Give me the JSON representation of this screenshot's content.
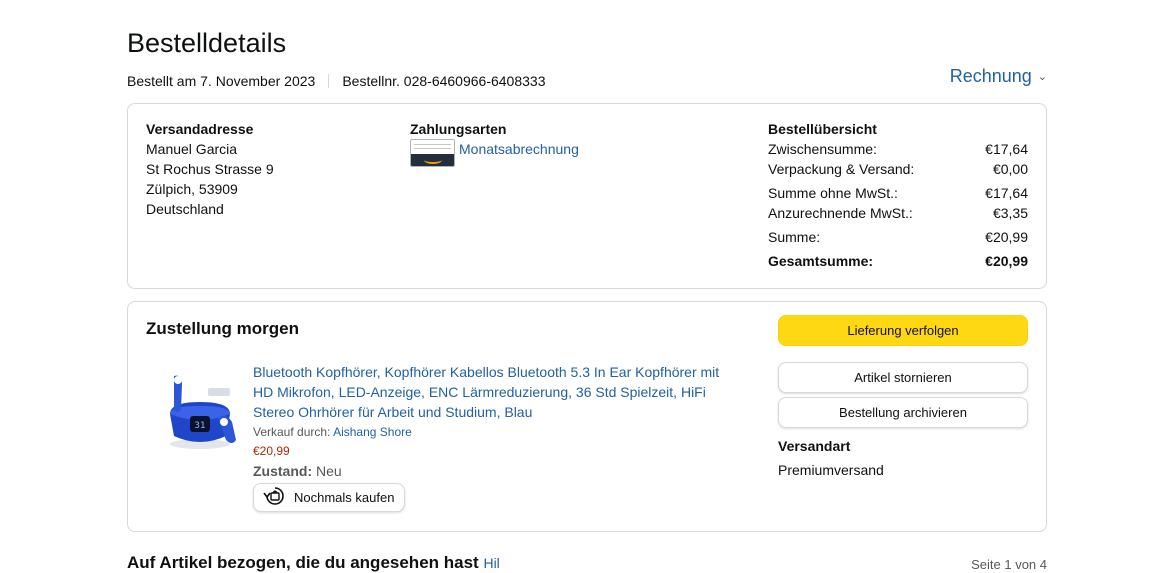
{
  "page": {
    "title": "Bestelldetails",
    "order_date": "Bestellt am 7. November 2023",
    "order_number": "Bestellnr. 028-6460966-6408333",
    "invoice_label": "Rechnung"
  },
  "shipping_address": {
    "title": "Versandadresse",
    "name": "Manuel Garcia",
    "street": "St Rochus Strasse 9",
    "city": "Zülpich, 53909",
    "country": "Deutschland"
  },
  "payment": {
    "title": "Zahlungsarten",
    "method": "Monatsabrechnung"
  },
  "summary": {
    "title": "Bestellübersicht",
    "rows": [
      {
        "label": "Zwischensumme:",
        "value": "€17,64"
      },
      {
        "label": "Verpackung & Versand:",
        "value": "€0,00"
      },
      {
        "label": "Summe ohne MwSt.:",
        "value": "€17,64"
      },
      {
        "label": "Anzurechnende MwSt.:",
        "value": "€3,35"
      },
      {
        "label": "Summe:",
        "value": "€20,99"
      },
      {
        "label": "Gesamtsumme:",
        "value": "€20,99"
      }
    ]
  },
  "delivery": {
    "title": "Zustellung morgen",
    "product_title": "Bluetooth Kopfhörer, Kopfhörer Kabellos Bluetooth 5.3 In Ear Kopfhörer mit HD Mikrofon, LED-Anzeige, ENC Lärmreduzierung, 36 Std Spielzeit, HiFi Stereo Ohrhörer für Arbeit und Studium, Blau",
    "seller_prefix": "Verkauf durch:",
    "seller_name": "Aishang Shore",
    "price": "€20,99",
    "condition_label": "Zustand:",
    "condition_value": "Neu",
    "buy_again_label": "Nochmals kaufen",
    "colors": {
      "accent": "#ffd814",
      "link": "#2162a1",
      "price": "#b12704"
    }
  },
  "actions": {
    "track": "Lieferung verfolgen",
    "cancel": "Artikel stornieren",
    "archive": "Bestellung archivieren",
    "shipping_type_title": "Versandart",
    "shipping_type": "Premiumversand"
  },
  "bottom": {
    "heading": "Auf Artikel bezogen, die du angesehen hast",
    "help_link": "Hil",
    "pager": "Seite 1 von 4"
  }
}
